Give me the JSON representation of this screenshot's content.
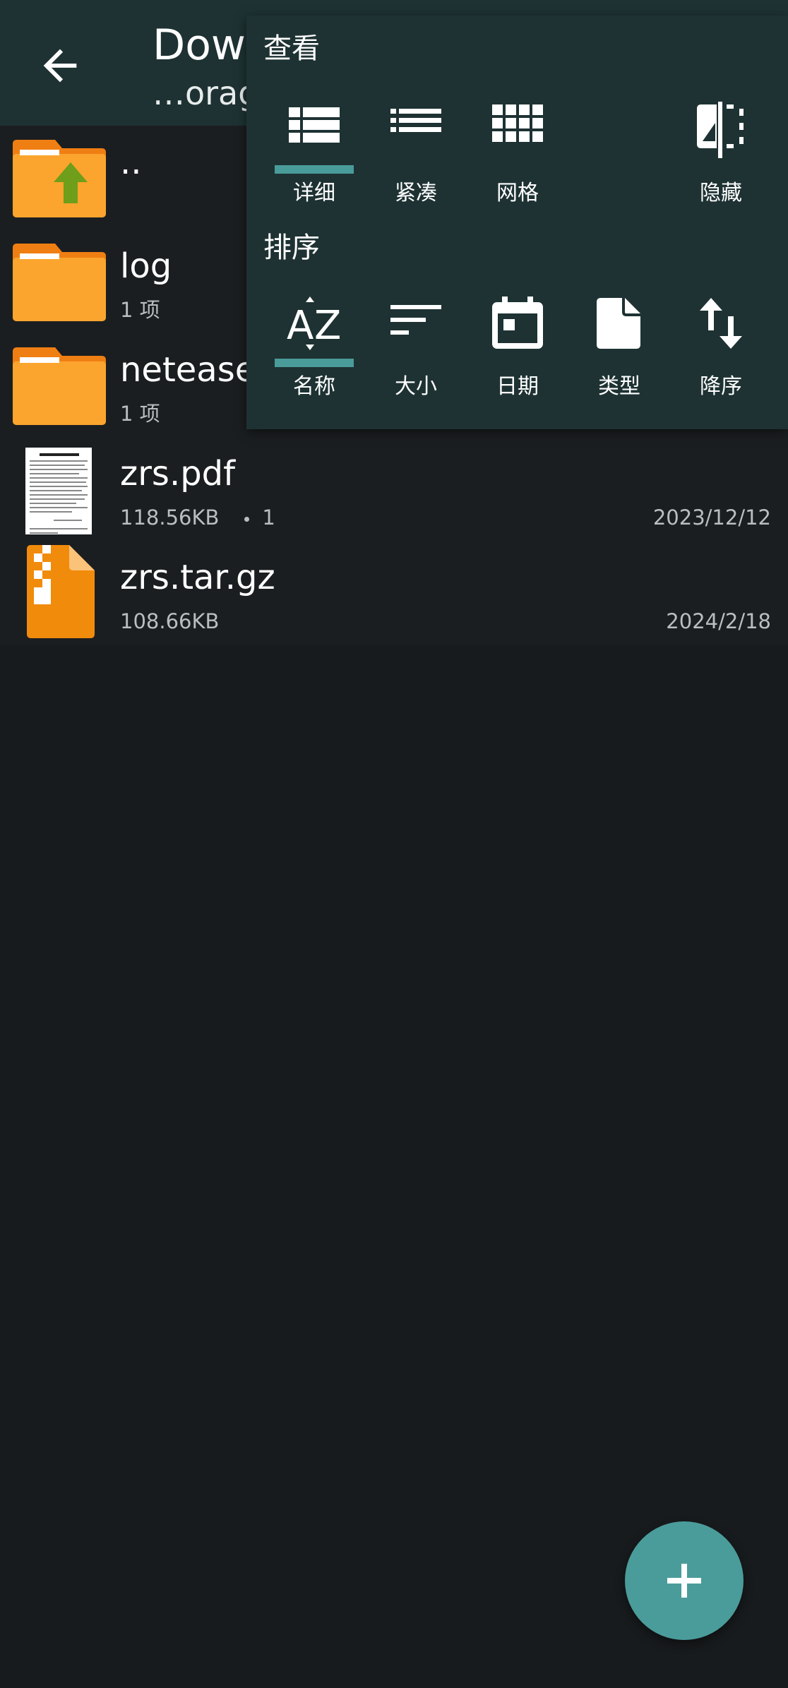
{
  "header": {
    "title": "Dow",
    "subtitle": "…orag"
  },
  "files": [
    {
      "name": "..",
      "icon": "folder-up-icon"
    },
    {
      "name": "log",
      "meta": "1 项",
      "icon": "folder-icon"
    },
    {
      "name": "netease",
      "meta": "1 项",
      "icon": "folder-icon"
    },
    {
      "name": "zrs.pdf",
      "size": "118.56KB",
      "pages": "1",
      "date": "2023/12/12",
      "icon": "pdf-thumbnail"
    },
    {
      "name": "zrs.tar.gz",
      "size": "108.66KB",
      "date": "2024/2/18",
      "icon": "archive-icon"
    }
  ],
  "popup": {
    "view_title": "查看",
    "view_options": [
      {
        "label": "详细",
        "icon": "list-detail-icon",
        "selected": true
      },
      {
        "label": "紧凑",
        "icon": "list-compact-icon",
        "selected": false
      },
      {
        "label": "网格",
        "icon": "grid-icon",
        "selected": false
      },
      {
        "label": "隐藏",
        "icon": "hidden-toggle-icon",
        "selected": false
      }
    ],
    "sort_title": "排序",
    "sort_options": [
      {
        "label": "名称",
        "icon": "sort-az-icon",
        "selected": true
      },
      {
        "label": "大小",
        "icon": "sort-size-icon",
        "selected": false
      },
      {
        "label": "日期",
        "icon": "calendar-icon",
        "selected": false
      },
      {
        "label": "类型",
        "icon": "file-type-icon",
        "selected": false
      },
      {
        "label": "降序",
        "icon": "sort-order-icon",
        "selected": false
      }
    ]
  },
  "colors": {
    "accent": "#4a9c9a",
    "header_bg": "#1e3233",
    "background": "#181b1d",
    "folder": "#fba52e"
  }
}
